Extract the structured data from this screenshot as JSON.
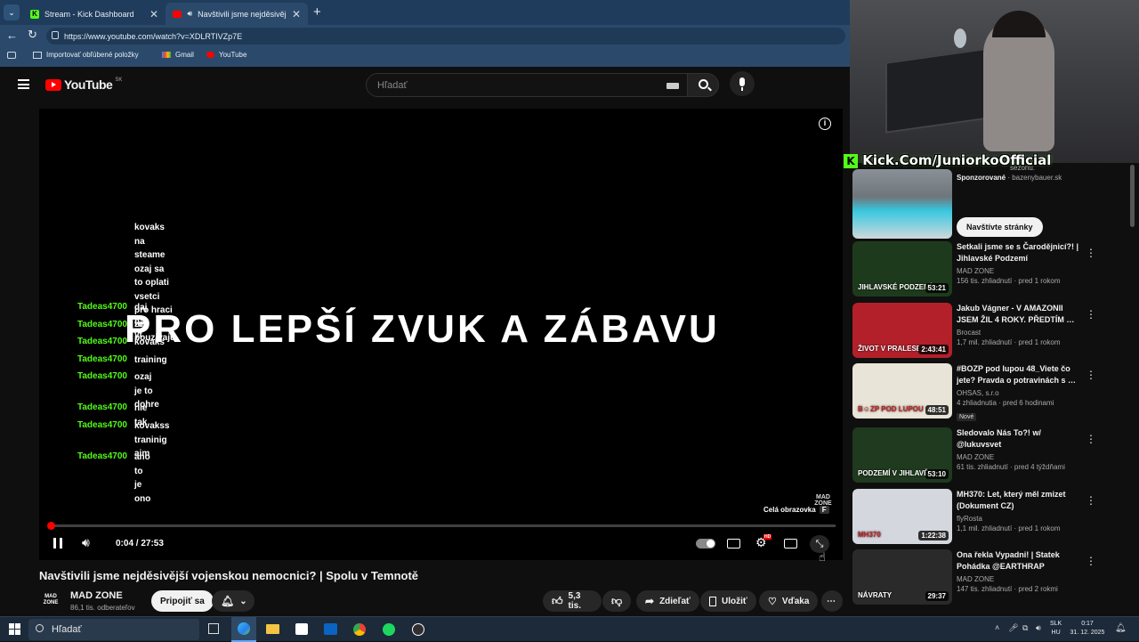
{
  "browser": {
    "tabs": [
      {
        "label": "Stream - Kick Dashboard",
        "close": "✕"
      },
      {
        "label": "Navštivili jsme nejděsivější voj…",
        "close": "✕"
      }
    ],
    "new_tab": "+",
    "url": "https://www.youtube.com/watch?v=XDLRTIVZp7E",
    "bookmarks": [
      "Importovať obľúbené položky",
      "Gmail",
      "YouTube"
    ]
  },
  "youtube": {
    "logo": "YouTube",
    "region": "SK",
    "search_placeholder": "Hľadať"
  },
  "player": {
    "chat_partial": [
      "kovaks na",
      "steame ozaj sa",
      "to oplati vsetci",
      "pro hraci to",
      "pouzivaju"
    ],
    "chat": [
      {
        "nick": "Tadeas4700",
        "lines": [
          "daj na yt"
        ]
      },
      {
        "nick": "Tadeas4700",
        "lines": [
          "ze"
        ]
      },
      {
        "nick": "Tadeas4700",
        "lines": [
          "kovaks"
        ]
      },
      {
        "nick": "Tadeas4700",
        "lines": [
          "training"
        ]
      },
      {
        "nick": "Tadeas4700",
        "lines": [
          "ozaj je to",
          "dohre"
        ]
      },
      {
        "nick": "Tadeas4700",
        "lines": [
          "nie tak"
        ]
      },
      {
        "nick": "Tadeas4700",
        "lines": [
          "kovakss",
          "traninig aim"
        ]
      },
      {
        "nick": "Tadeas4700",
        "lines": [
          "ano to je ono"
        ]
      }
    ],
    "overlay_text": "PRO LEPŠÍ ZVUK A ZÁBAVU",
    "watermark": "MAD ZONE",
    "fullscreen_tooltip": "Celá obrazovka",
    "fullscreen_key": "F",
    "time": "0:04 / 27:53",
    "progress": 0.0024,
    "quality_badge": "HD"
  },
  "video": {
    "title": "Navštivili jsme nejděsivější vojenskou nemocnici? | Spolu v Temnotě",
    "channel": "MAD ZONE",
    "subscribers": "86,1 tis. odberateľov",
    "join": "Pripojiť sa",
    "likes": "5,3 tis.",
    "share": "Zdieľať",
    "save": "Uložiť",
    "thanks": "Vďaka",
    "channel_logo": "MAD ZONE"
  },
  "sidebar": {
    "ad": {
      "title_tail": "sezónu.",
      "sponsored": "Sponzorované",
      "domain": "bazenybauer.sk",
      "button": "Navštívte stránky"
    },
    "videos": [
      {
        "title": "Setkali jsme se s Čarodějnicí?! | Jihlavské Podzemí",
        "channel": "MAD ZONE",
        "meta": "156 tis. zhliadnutí · pred 1 rokom",
        "duration": "53:21",
        "thumb_text": "JIHLAVSKÉ PODZEMÍ",
        "thumb_color": "#1d3b1c"
      },
      {
        "title": "Jakub Vágner - V AMAZONII JSEM ŽIL 4 ROKY. PŘEDTÍM …",
        "channel": "Brocast",
        "meta": "1,7 mil. zhliadnutí · pred 1 rokom",
        "duration": "2:43:41",
        "thumb_text": "ŽIVOT V PRALESE",
        "thumb_color": "#b3202a"
      },
      {
        "title": "#BOZP pod lupou 48_Viete čo jete? Pravda o potravinách s …",
        "channel": "OHSAS, s.r.o",
        "meta": "4 zhliadnutia · pred 6 hodinami",
        "duration": "48:51",
        "badge": "Nové",
        "thumb_text": "B☺ZP POD LUPOU",
        "thumb_color": "#e9e4d8"
      },
      {
        "title": "Sledovalo Nás To?! w/ @lukuvsvet",
        "channel": "MAD ZONE",
        "meta": "61 tis. zhliadnutí · pred 4 týždňami",
        "duration": "53:10",
        "thumb_text": "PODZEMÍ V JIHLAVĚ",
        "thumb_color": "#1f3a1e"
      },
      {
        "title": "MH370: Let, který měl zmizet (Dokument CZ)",
        "channel": "flyRosta",
        "meta": "1,1 mil. zhliadnutí · pred 1 rokom",
        "duration": "1:22:38",
        "thumb_text": "MH370",
        "thumb_color": "#d4d8de"
      },
      {
        "title": "Ona řekla Vypadni! | Statek Pohádka @EARTHRAP",
        "channel": "MAD ZONE",
        "meta": "147 tis. zhliadnutí · pred 2 rokmi",
        "duration": "29:37",
        "thumb_text": "NÁVRATY",
        "thumb_color": "#2a2a2a"
      }
    ]
  },
  "stream_overlay": {
    "kick_url": "Kick.Com/JuniorkoOfficial"
  },
  "taskbar": {
    "search": "Hľadať",
    "lang_top": "SLK",
    "lang_bottom": "HU",
    "time": "0:17",
    "date": "31. 12. 2025"
  },
  "colors": {
    "kick_green": "#53fc18",
    "yt_red": "#ff0000",
    "browser_blue": "#1f3c5c"
  }
}
